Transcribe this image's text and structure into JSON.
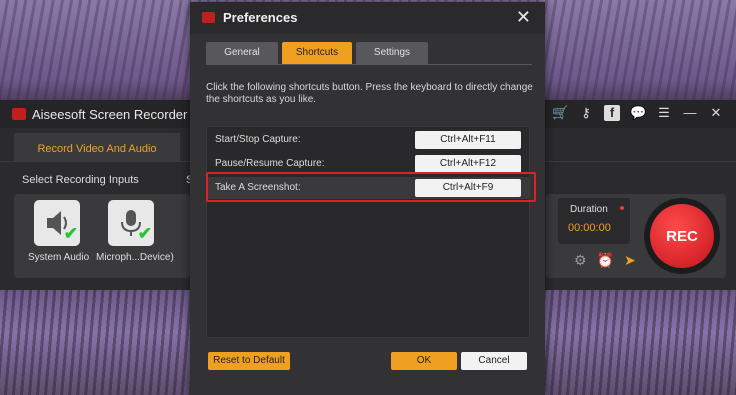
{
  "app": {
    "title": "Aiseesoft Screen Recorder",
    "tab_record": "Record Video And Audio",
    "select_inputs": "Select Recording Inputs",
    "select_s": "S",
    "sources": [
      {
        "label": "System Audio",
        "icon": "speaker-icon"
      },
      {
        "label": "Microph...Device)",
        "icon": "microphone-icon"
      }
    ],
    "duration_label": "Duration",
    "duration_value": "00:00:00",
    "rec_label": "REC",
    "title_icons": [
      "cart-icon",
      "key-icon",
      "facebook-icon",
      "chat-icon",
      "menu-icon",
      "minimize-icon",
      "close-icon"
    ]
  },
  "dialog": {
    "title": "Preferences",
    "tabs": [
      {
        "label": "General",
        "active": false
      },
      {
        "label": "Shortcuts",
        "active": true
      },
      {
        "label": "Settings",
        "active": false
      }
    ],
    "description": "Click the following shortcuts button. Press the keyboard to directly change the shortcuts as you like.",
    "shortcuts": [
      {
        "label": "Start/Stop Capture:",
        "key": "Ctrl+Alt+F11",
        "highlighted": false
      },
      {
        "label": "Pause/Resume Capture:",
        "key": "Ctrl+Alt+F12",
        "highlighted": false
      },
      {
        "label": "Take A Screenshot:",
        "key": "Ctrl+Alt+F9",
        "highlighted": true
      }
    ],
    "reset_label": "Reset to Default",
    "ok_label": "OK",
    "cancel_label": "Cancel"
  },
  "colors": {
    "accent": "#f0a020",
    "rec_red": "#c4141b",
    "highlight_frame": "#d8232a",
    "check_green": "#27c43a"
  }
}
